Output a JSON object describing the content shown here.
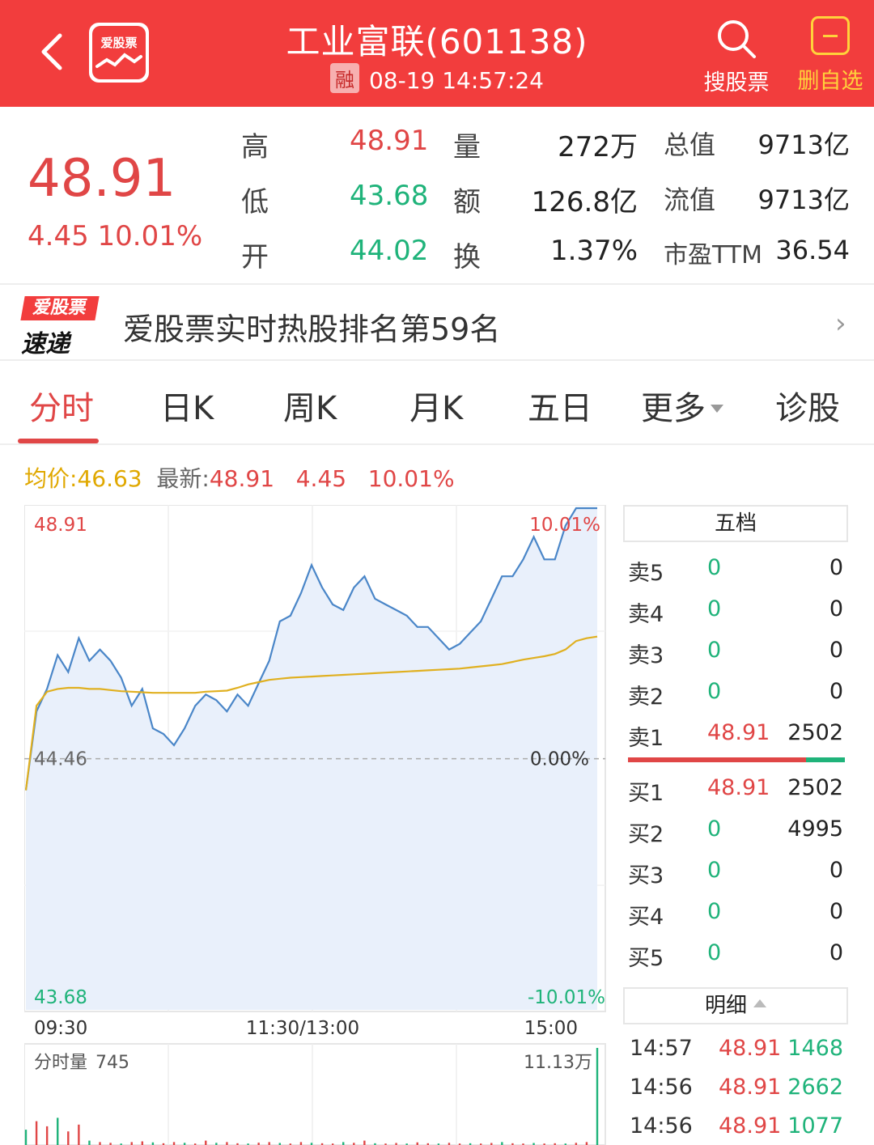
{
  "header": {
    "title": "工业富联(601138)",
    "margin_badge": "融",
    "datetime": "08-19 14:57:24",
    "logo_text": "爱股票",
    "search_label": "搜股票",
    "watchlist_label": "删自选",
    "bg_color": "#f23d3d"
  },
  "quote": {
    "price": "48.91",
    "change": "4.45",
    "change_pct": "10.01%",
    "rows": [
      {
        "l1": "高",
        "v1": "48.91",
        "l2": "量",
        "v2": "272万",
        "l3": "总值",
        "v3": "9713亿"
      },
      {
        "l1": "低",
        "v1": "43.68",
        "l2": "额",
        "v2": "126.8亿",
        "l3": "流值",
        "v3": "9713亿"
      },
      {
        "l1": "开",
        "v1": "44.02",
        "l2": "换",
        "v2": "1.37%",
        "l3": "市盈TTM",
        "v3": "36.54"
      }
    ]
  },
  "banner": {
    "logo_top": "爱股票",
    "logo_bottom": "速递",
    "text": "爱股票实时热股排名第59名",
    "arrow": "›"
  },
  "tabs": {
    "items": [
      "分时",
      "日K",
      "周K",
      "月K",
      "五日",
      "更多",
      "诊股"
    ],
    "active": 0
  },
  "info_line": {
    "avg_label": "均价:",
    "avg_value": "46.63",
    "last_label": "最新:",
    "last_value": "48.91",
    "chg": "4.45",
    "pct": "10.01%"
  },
  "chart_data": {
    "type": "line",
    "title": "",
    "y_top_label": "48.91",
    "y_mid_label": "44.46",
    "y_bottom_label": "43.68",
    "pct_top_label": "10.01%",
    "pct_mid_label": "0.00%",
    "pct_bottom_label": "-10.01%",
    "x_labels": [
      "09:30",
      "11:30/13:00",
      "15:00"
    ],
    "ylim": [
      40.0,
      48.91
    ],
    "prev_close": 44.46,
    "price_color": "#4a86c8",
    "avg_color": "#e0b020",
    "series": [
      {
        "name": "最新",
        "values": [
          43.9,
          45.3,
          45.7,
          46.3,
          46.0,
          46.6,
          46.2,
          46.4,
          46.2,
          45.9,
          45.4,
          45.7,
          45.0,
          44.9,
          44.7,
          45.0,
          45.4,
          45.6,
          45.5,
          45.3,
          45.6,
          45.4,
          45.8,
          46.2,
          46.9,
          47.0,
          47.4,
          47.9,
          47.5,
          47.2,
          47.1,
          47.5,
          47.7,
          47.3,
          47.2,
          47.1,
          47.0,
          46.8,
          46.8,
          46.6,
          46.4,
          46.5,
          46.7,
          46.9,
          47.3,
          47.7,
          47.7,
          48.0,
          48.4,
          48.0,
          48.0,
          48.6,
          48.91,
          48.91,
          48.91
        ]
      },
      {
        "name": "均价",
        "values": [
          43.9,
          45.4,
          45.65,
          45.7,
          45.72,
          45.72,
          45.7,
          45.7,
          45.68,
          45.66,
          45.65,
          45.64,
          45.63,
          45.63,
          45.63,
          45.63,
          45.63,
          45.65,
          45.66,
          45.67,
          45.72,
          45.78,
          45.82,
          45.86,
          45.88,
          45.9,
          45.91,
          45.92,
          45.93,
          45.94,
          45.95,
          45.96,
          45.97,
          45.98,
          45.99,
          46.0,
          46.01,
          46.02,
          46.03,
          46.04,
          46.05,
          46.06,
          46.08,
          46.1,
          46.12,
          46.14,
          46.18,
          46.22,
          46.25,
          46.28,
          46.32,
          46.4,
          46.55,
          46.6,
          46.63
        ]
      }
    ],
    "volume": {
      "label": "分时量",
      "current": "745",
      "max_label": "11.13万",
      "bars": [
        0.45,
        0.7,
        0.55,
        0.8,
        0.4,
        0.6,
        0.3,
        0.2,
        0.15,
        0.1,
        0.2,
        0.25,
        0.18,
        0.12,
        0.2,
        0.15,
        0.1,
        0.3,
        0.15,
        0.2,
        0.12,
        0.1,
        0.16,
        0.2,
        0.14,
        0.1,
        0.2,
        0.15,
        0.12,
        0.1,
        0.2,
        0.15,
        0.3,
        0.12,
        0.1,
        0.14,
        0.1,
        0.18,
        0.12,
        0.1,
        0.15,
        0.1,
        0.12,
        0.1,
        0.14,
        0.2,
        0.12,
        0.1,
        0.14,
        0.1,
        0.12,
        0.1,
        0.15,
        0.2,
        1.0
      ]
    }
  },
  "order_book": {
    "title": "五档",
    "asks": [
      {
        "label": "卖5",
        "price": "0",
        "vol": "0"
      },
      {
        "label": "卖4",
        "price": "0",
        "vol": "0"
      },
      {
        "label": "卖3",
        "price": "0",
        "vol": "0"
      },
      {
        "label": "卖2",
        "price": "0",
        "vol": "0"
      },
      {
        "label": "卖1",
        "price": "48.91",
        "vol": "2502"
      }
    ],
    "bids": [
      {
        "label": "买1",
        "price": "48.91",
        "vol": "2502"
      },
      {
        "label": "买2",
        "price": "0",
        "vol": "4995"
      },
      {
        "label": "买3",
        "price": "0",
        "vol": "0"
      },
      {
        "label": "买4",
        "price": "0",
        "vol": "0"
      },
      {
        "label": "买5",
        "price": "0",
        "vol": "0"
      }
    ]
  },
  "details": {
    "title": "明细",
    "rows": [
      {
        "time": "14:57",
        "price": "48.91",
        "vol": "1468"
      },
      {
        "time": "14:56",
        "price": "48.91",
        "vol": "2662"
      },
      {
        "time": "14:56",
        "price": "48.91",
        "vol": "1077"
      }
    ]
  }
}
